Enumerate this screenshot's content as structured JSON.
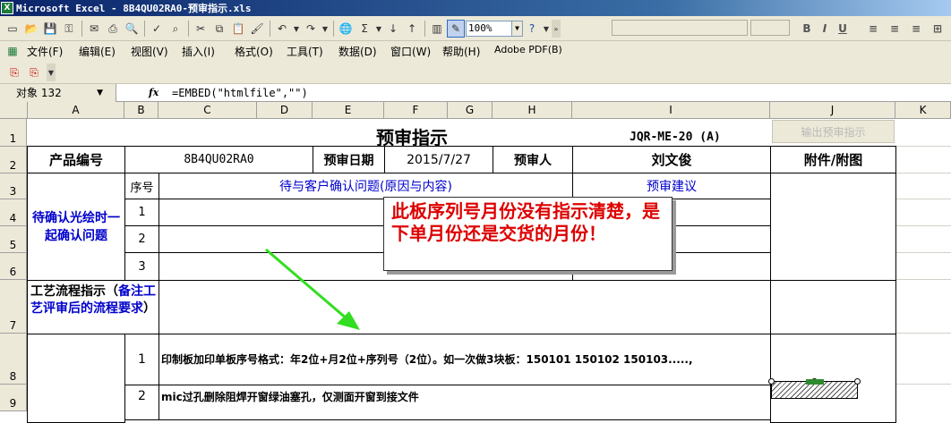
{
  "window": {
    "title": "Microsoft Excel - 8B4QU02RA0-预审指示.xls",
    "icon_label": "X"
  },
  "toolbar": {
    "zoom": "100%",
    "font_name": "",
    "font_size": "",
    "bold_label": "B",
    "italic_label": "I",
    "underline_label": "U"
  },
  "menu": {
    "items": [
      "文件(F)",
      "编辑(E)",
      "视图(V)",
      "插入(I)",
      "格式(O)",
      "工具(T)",
      "数据(D)",
      "窗口(W)",
      "帮助(H)",
      "Adobe PDF(B)"
    ]
  },
  "formula_bar": {
    "name_box": "对象 132",
    "fx": "fx",
    "formula": "=EMBED(\"htmlfile\",\"\")"
  },
  "columns": [
    "A",
    "B",
    "C",
    "D",
    "E",
    "F",
    "G",
    "H",
    "I",
    "J",
    "K"
  ],
  "rows": [
    "1",
    "2",
    "3",
    "4",
    "5",
    "6",
    "7",
    "8",
    "9"
  ],
  "sheet": {
    "title": "预审指示",
    "doc_code": "JQR-ME-20 (A)",
    "export_button": "输出预审指示",
    "product_no_label": "产品编号",
    "product_no": "8B4QU02RA0",
    "review_date_label": "预审日期",
    "review_date": "2015/7/27",
    "reviewer_label": "预审人",
    "reviewer": "刘文俊",
    "attachment_label": "附件/附图",
    "seq_label": "序号",
    "question_header": "待与客户确认问题(原因与内容)",
    "suggestion_header": "预审建议",
    "pending_label": "待确认光绘时一起确认问题",
    "seq_1": "1",
    "seq_2": "2",
    "seq_3": "3",
    "process_label_a": "工艺流程指示（",
    "process_label_b": "备注工艺评审后的流程要求",
    "process_label_c": "）",
    "item_1_no": "1",
    "item_1_text": "印制板加印单板序号格式：年2位+月2位+序列号（2位）。如一次做3块板：150101    150102    150103.....,",
    "item_2_no": "2",
    "item_2_text": "mic过孔删除阻焊开窗绿油塞孔，仅测面开窗到接文件"
  },
  "annotation": {
    "callout_text": "此板序列号月份没有指示清楚，是下单月份还是交货的月份！",
    "callout_color": "#dd0000",
    "arrow_color": "#33dd22"
  }
}
